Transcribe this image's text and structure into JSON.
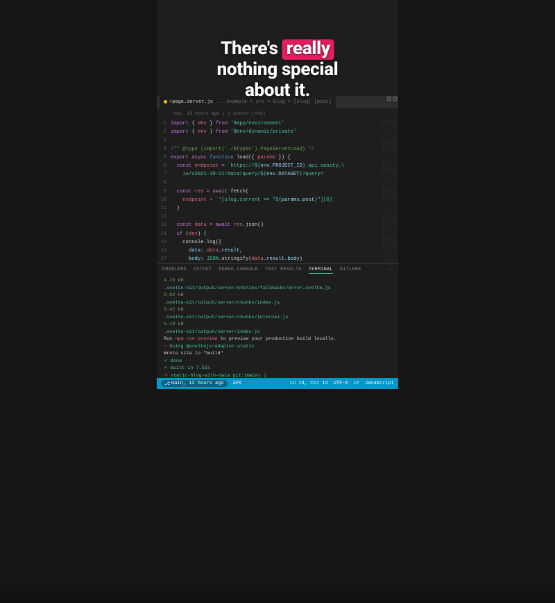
{
  "caption": {
    "line1_a": "There's ",
    "line1_hl": "really",
    "line2": "nothing special",
    "line3": "about it."
  },
  "tab": {
    "filename": "+page.server.js",
    "context": "...example > src > blog > [slug] [post]"
  },
  "git_info": "You, 12 hours ago | 1 author (You)",
  "code": [
    {
      "n": 1,
      "html": "<span class='kw'>import</span> <span class='punc'>{</span> <span class='var'>dev</span> <span class='punc'>}</span> <span class='kw'>from</span> <span class='str'>'$app/environment'</span>"
    },
    {
      "n": 2,
      "html": "<span class='kw'>import</span> <span class='punc'>{</span> <span class='var'>env</span> <span class='punc'>}</span> <span class='kw'>from</span> <span class='str'>'$env/dynamic/private'</span>"
    },
    {
      "n": 3,
      "html": ""
    },
    {
      "n": 4,
      "html": "<span class='cmt'>/** @type {import('./$types').PageServerLoad} */</span>"
    },
    {
      "n": 5,
      "html": "<span class='kw'>export</span> <span class='kw'>async</span> <span class='fn'>function</span> <span class='id'>load</span><span class='punc'>({</span> <span class='var'>params</span> <span class='punc'>}) {</span>"
    },
    {
      "n": 6,
      "html": "  <span class='kw'>const</span> <span class='var'>endpoint</span> <span class='op'>=</span> <span class='str'>`https://${</span><span class='prop'>env.PROJECT_ID</span><span class='str'>}.api.sanity.\\</span>"
    },
    {
      "n": 7,
      "html": "    <span class='str'>io/v2021-10-21/data/query/${</span><span class='prop'>env.DATASET</span><span class='str'>}?query=`</span>"
    },
    {
      "n": 8,
      "html": ""
    },
    {
      "n": 9,
      "html": "  <span class='kw'>const</span> <span class='var'>res</span> <span class='op'>=</span> <span class='kw'>await</span> <span class='id'>fetch</span><span class='punc'>(</span>"
    },
    {
      "n": 10,
      "html": "    <span class='var'>endpoint</span> <span class='op'>+</span> <span class='str'>`*[slug.current == \"${</span><span class='prop'>params.post</span><span class='str'>}\"][0]`</span>"
    },
    {
      "n": 11,
      "html": "  <span class='punc'>)</span>"
    },
    {
      "n": 12,
      "html": ""
    },
    {
      "n": 13,
      "html": "  <span class='kw'>const</span> <span class='var'>data</span> <span class='op'>=</span> <span class='kw'>await</span> <span class='var'>res</span><span class='punc'>.</span><span class='id'>json</span><span class='punc'>()</span>"
    },
    {
      "n": 14,
      "html": "  <span class='kw'>if</span> <span class='punc'>(</span><span class='var'>dev</span><span class='punc'>) {</span>"
    },
    {
      "n": 15,
      "html": "    <span class='id'>console</span><span class='punc'>.</span><span class='id'>log</span><span class='punc'>({</span>"
    },
    {
      "n": 16,
      "html": "      <span class='prop'>data</span><span class='punc'>:</span> <span class='var'>data</span><span class='punc'>.</span><span class='prop'>result</span><span class='punc'>,</span>"
    },
    {
      "n": 17,
      "html": "      <span class='prop'>body</span><span class='punc'>:</span> <span class='type'>JSON</span><span class='punc'>.</span><span class='id'>stringify</span><span class='punc'>(</span><span class='var'>data</span><span class='punc'>.</span><span class='prop'>result</span><span class='punc'>.</span><span class='prop'>body</span><span class='punc'>)</span>"
    }
  ],
  "panel_tabs": [
    "PROBLEMS",
    "OUTPUT",
    "DEBUG CONSOLE",
    "TEST RESULTS",
    "TERMINAL",
    "GITLENS"
  ],
  "panel_active": "TERMINAL",
  "terminal": [
    {
      "size": "4.78 kB",
      "path": ".svelte-kit/output/server/entries/fallbacks/error.svelte.js"
    },
    {
      "size": "0.92 kB",
      "path": ".svelte-kit/output/server/chunks/index.js"
    },
    {
      "size": "3.42 kB",
      "path": ".svelte-kit/output/server/chunks/internal.js"
    },
    {
      "size": "5.18 kB",
      "path": ".svelte-kit/output/server/index.js"
    }
  ],
  "terminal_msgs": {
    "preview": "Run npm run preview to preview your production build locally.",
    "adapter": "Using @sveltejs/adapter-static",
    "wrote": "Wrote site to \"build\"",
    "done": "✓ done",
    "built": "✓ built in 7.52s",
    "prompt": "static-blog-with-data git:(main) "
  },
  "status": {
    "branch": "main, 12 hours ago",
    "afk": "AFK",
    "pos": "Ln 14, Col 14",
    "encoding": "UTF-8",
    "eol": "LF",
    "lang": "JavaScript"
  },
  "bg_code": [
    {
      "n": 2,
      "html": "<span class='kw'>import</span> <span class='punc'>{</span> <span class='var'>en</span>"
    },
    {
      "n": 3,
      "html": ""
    },
    {
      "n": 4,
      "html": "<span class='cmt'>/** @type</span>"
    },
    {
      "n": 5,
      "html": "<span class='kw'>export</span> <span class='kw'>asyn</span>"
    },
    {
      "n": 6,
      "html": "  <span class='kw'>const</span> <span class='var'>endp</span>"
    },
    {
      "n": 7,
      "html": "    <span class='str'>io/v202</span>"
    },
    {
      "n": 8,
      "html": ""
    },
    {
      "n": 9,
      "html": "  <span class='kw'>const</span> <span class='var'>res</span>"
    },
    {
      "n": 10,
      "html": "    <span class='var'>endpoin</span>"
    },
    {
      "n": 11,
      "html": "  <span class='punc'>)</span>"
    },
    {
      "n": 12,
      "html": ""
    },
    {
      "n": 13,
      "html": "  <span class='kw'>const</span> <span class='var'>data</span>"
    },
    {
      "n": 14,
      "html": "  <span class='kw'>if</span> <span class='punc'>(</span><span class='var'>dev</span><span class='punc'>)</span>",
      "active": true
    },
    {
      "n": 15,
      "html": "    <span class='id'>console</span>"
    },
    {
      "n": 16,
      "html": "      <span class='prop'>data:</span>"
    },
    {
      "n": 17,
      "html": "      <span class='prop'>body:</span>"
    }
  ],
  "bg_term_size": "4.78 kB"
}
